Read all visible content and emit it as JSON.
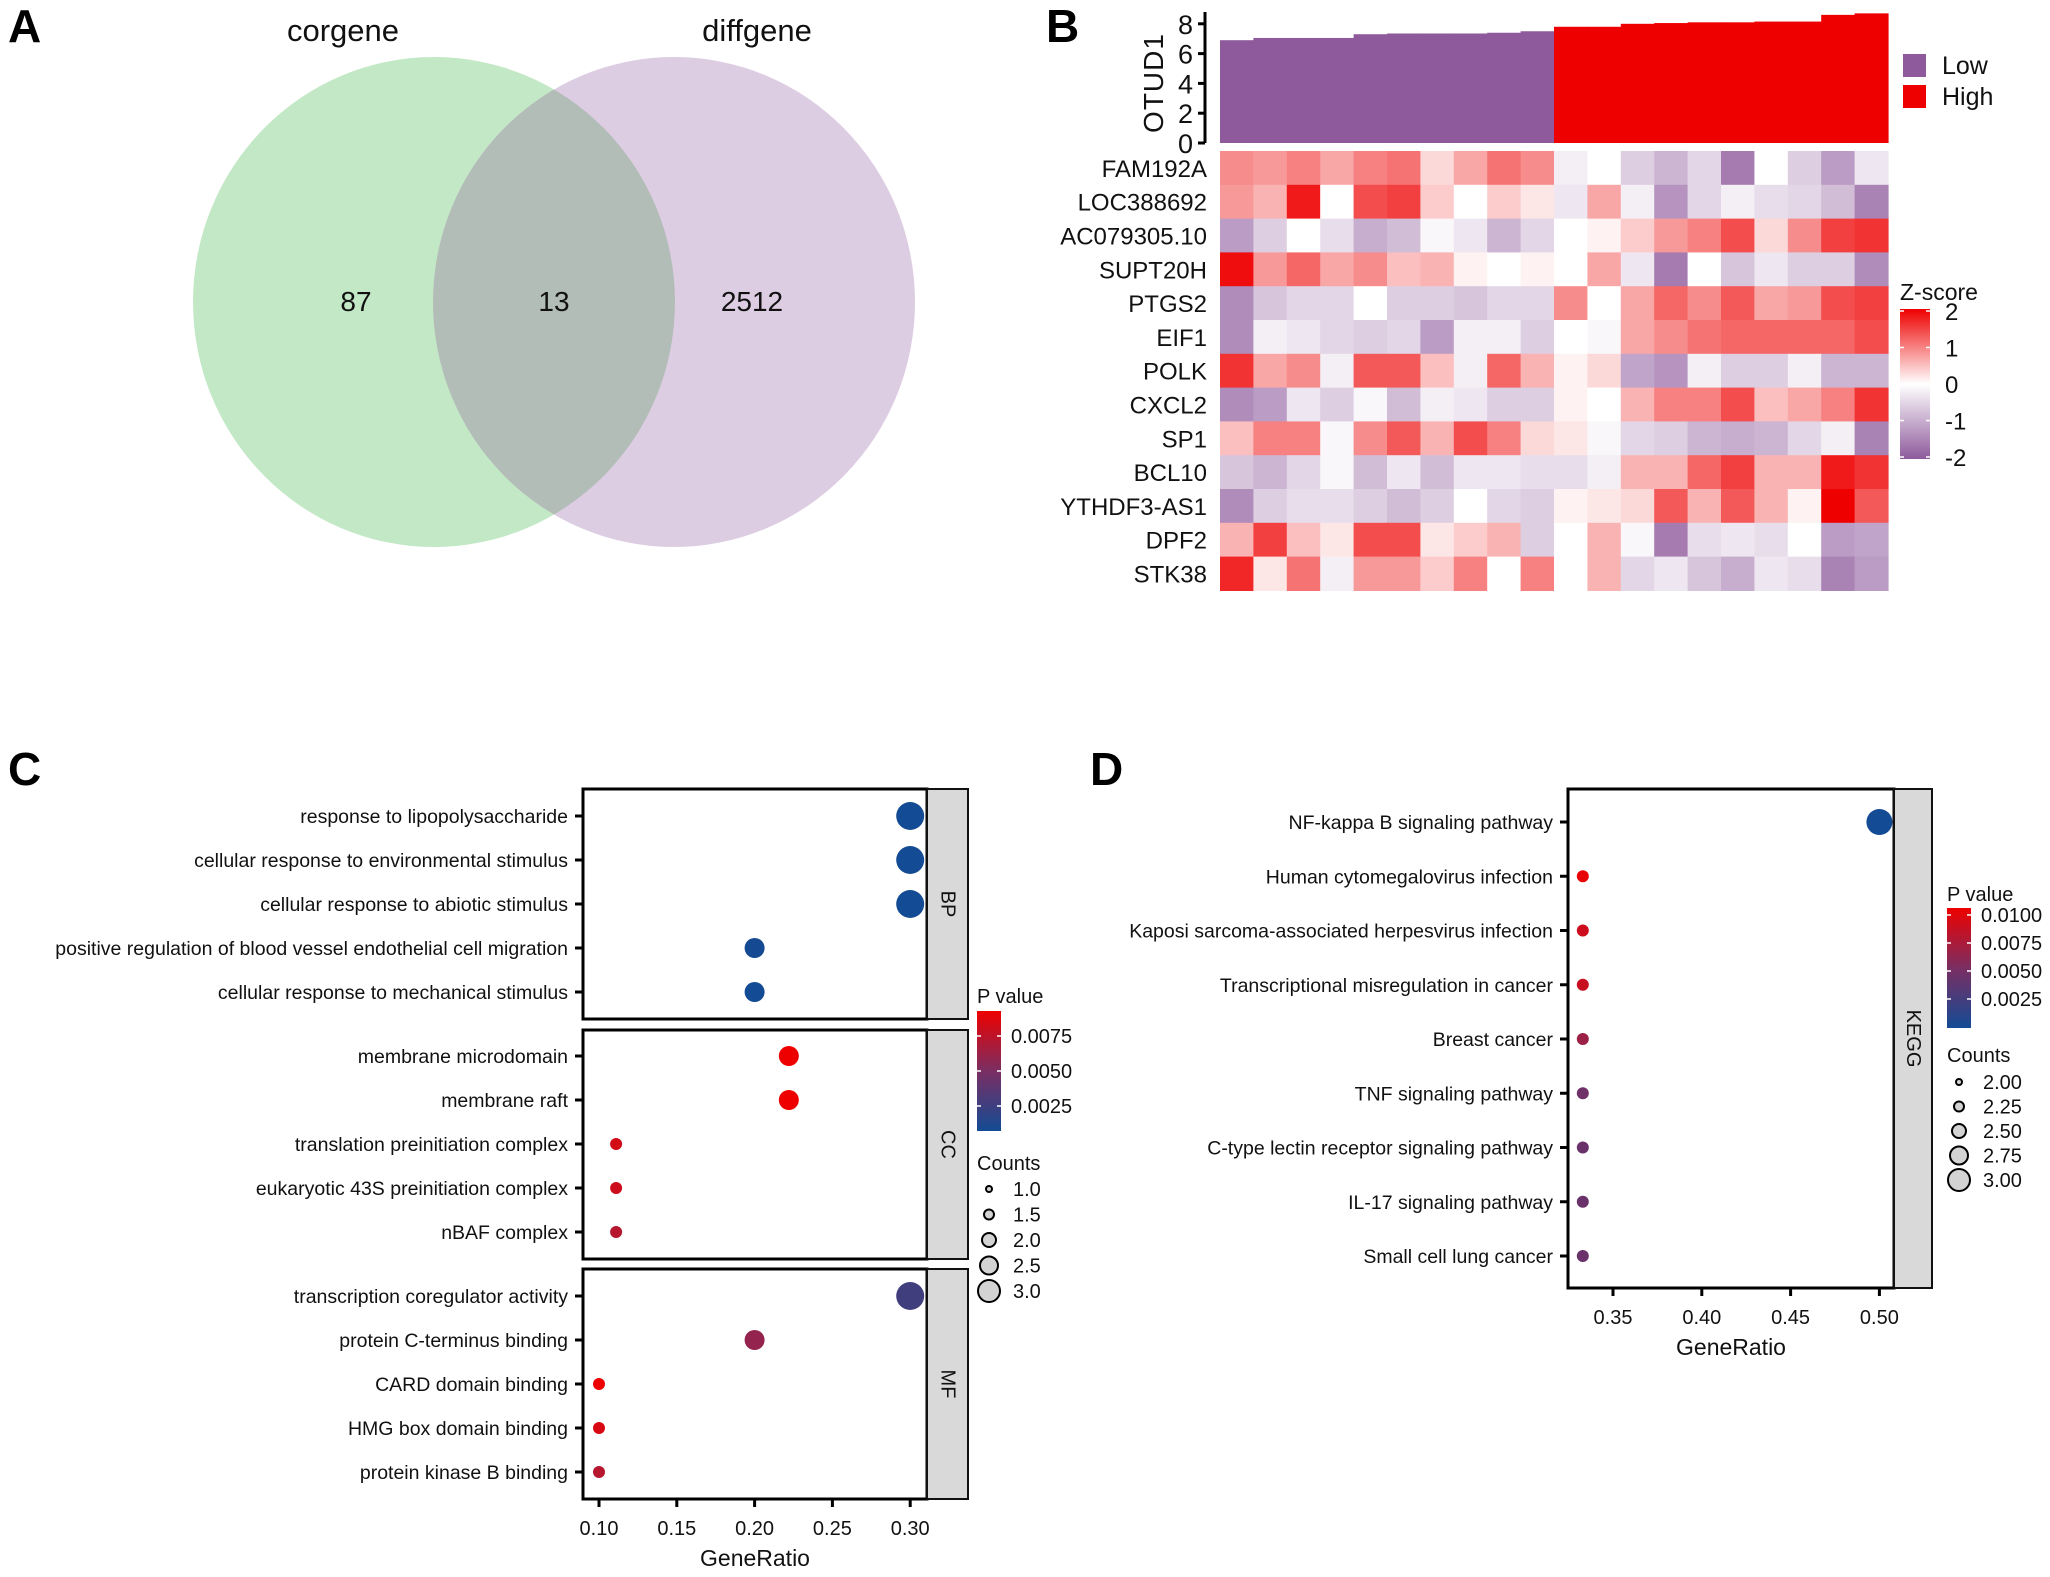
{
  "panels": {
    "A": {
      "letter": "A"
    },
    "B": {
      "letter": "B"
    },
    "C": {
      "letter": "C"
    },
    "D": {
      "letter": "D"
    }
  },
  "chart_data": [
    {
      "id": "A",
      "type": "venn",
      "sets": [
        {
          "name": "corgene",
          "color": "#3aab3a",
          "fill": "#c3e8c6"
        },
        {
          "name": "diffgene",
          "color": "#8e5a9c",
          "fill": "#ddcde3"
        }
      ],
      "overlap_fill": "#b3bdb7",
      "counts": {
        "corgene_only": "87",
        "both": "13",
        "diffgene_only": "2512"
      }
    },
    {
      "id": "B",
      "type": "heatmap",
      "annotation": {
        "ylabel": "OTUD1",
        "yticks": [
          "0",
          "2",
          "4",
          "6",
          "8"
        ],
        "ylim": [
          0,
          8
        ],
        "values": [
          6.9,
          7.05,
          7.05,
          7.05,
          7.3,
          7.35,
          7.35,
          7.35,
          7.4,
          7.5,
          7.8,
          7.8,
          8.0,
          8.05,
          8.1,
          8.1,
          8.15,
          8.15,
          8.6,
          8.7
        ],
        "groups": [
          "Low",
          "Low",
          "Low",
          "Low",
          "Low",
          "Low",
          "Low",
          "Low",
          "Low",
          "Low",
          "High",
          "High",
          "High",
          "High",
          "High",
          "High",
          "High",
          "High",
          "High",
          "High"
        ],
        "legend": [
          {
            "label": "Low",
            "color": "#8e5a9c"
          },
          {
            "label": "High",
            "color": "#ee0000"
          }
        ]
      },
      "rows": [
        "FAM192A",
        "LOC388692",
        "AC079305.10",
        "SUPT20H",
        "PTGS2",
        "EIF1",
        "POLK",
        "CXCL2",
        "SP1",
        "BCL10",
        "YTHDF3-AS1",
        "DPF2",
        "STK38"
      ],
      "values": [
        [
          0.9,
          0.8,
          1.0,
          0.7,
          1.0,
          1.1,
          0.3,
          0.7,
          1.1,
          0.9,
          -0.2,
          0,
          -0.6,
          -0.9,
          -0.5,
          -1.6,
          0,
          -0.6,
          -1.2,
          -0.3
        ],
        [
          0.8,
          0.6,
          1.8,
          0,
          1.4,
          1.5,
          0.4,
          0,
          0.4,
          0.2,
          -0.3,
          0.7,
          -0.2,
          -1.3,
          -0.5,
          -0.2,
          -0.4,
          -0.5,
          -0.8,
          -1.5
        ],
        [
          -1.2,
          -0.6,
          0,
          -0.4,
          -1.0,
          -0.8,
          -0.1,
          -0.3,
          -0.9,
          -0.5,
          0,
          0.1,
          0.4,
          0.8,
          1.0,
          1.4,
          0.3,
          0.9,
          1.5,
          1.6
        ],
        [
          1.9,
          0.8,
          1.2,
          0.7,
          0.9,
          0.5,
          0.6,
          0.1,
          0,
          0.1,
          0,
          0.7,
          -0.3,
          -1.6,
          0,
          -0.7,
          -0.3,
          -0.6,
          -0.6,
          -1.4
        ],
        [
          -1.4,
          -0.7,
          -0.5,
          -0.5,
          0,
          -0.6,
          -0.6,
          -0.7,
          -0.5,
          -0.5,
          0.9,
          0,
          0.7,
          1.2,
          0.9,
          1.3,
          0.7,
          0.8,
          1.4,
          1.5
        ],
        [
          -1.4,
          -0.2,
          -0.3,
          -0.5,
          -0.6,
          -0.5,
          -1.2,
          -0.2,
          -0.2,
          -0.6,
          0,
          -0.1,
          0.7,
          0.9,
          1.1,
          1.2,
          1.2,
          1.2,
          1.2,
          1.4
        ],
        [
          1.6,
          0.7,
          0.9,
          -0.2,
          1.3,
          1.3,
          0.5,
          -0.2,
          1.2,
          0.6,
          0.1,
          0.3,
          -1.1,
          -1.3,
          -0.2,
          -0.6,
          -0.6,
          -0.2,
          -0.9,
          -0.9
        ],
        [
          -1.4,
          -1.2,
          -0.3,
          -0.6,
          -0.1,
          -0.8,
          -0.2,
          -0.3,
          -0.6,
          -0.6,
          0.1,
          0,
          0.6,
          1.0,
          1.0,
          1.4,
          0.5,
          0.7,
          1.0,
          1.6
        ],
        [
          0.5,
          1.0,
          1.0,
          -0.1,
          0.9,
          1.3,
          0.6,
          1.4,
          1.0,
          0.3,
          0.2,
          -0.1,
          -0.5,
          -0.6,
          -0.9,
          -1.0,
          -0.9,
          -0.5,
          -0.2,
          -1.5
        ],
        [
          -0.7,
          -0.9,
          -0.5,
          -0.1,
          -0.8,
          -0.3,
          -0.8,
          -0.3,
          -0.3,
          -0.4,
          -0.4,
          -0.2,
          0.6,
          0.6,
          1.2,
          1.5,
          0.6,
          0.6,
          1.8,
          1.6
        ],
        [
          -1.4,
          -0.6,
          -0.4,
          -0.4,
          -0.6,
          -0.8,
          -0.6,
          0,
          -0.5,
          -0.6,
          0.1,
          0.2,
          0.3,
          1.3,
          0.6,
          1.3,
          0.6,
          0.1,
          2.0,
          1.3
        ],
        [
          0.6,
          1.5,
          0.5,
          0.2,
          1.4,
          1.4,
          0.2,
          0.4,
          0.6,
          -0.6,
          0,
          0.6,
          -0.1,
          -1.6,
          -0.4,
          -0.3,
          -0.4,
          0,
          -1.2,
          -1.1
        ],
        [
          1.7,
          0.2,
          1.1,
          -0.2,
          0.8,
          0.8,
          0.4,
          1.0,
          0,
          1.0,
          0,
          0.6,
          -0.5,
          -0.3,
          -0.7,
          -1.0,
          -0.3,
          -0.4,
          -1.5,
          -1.2
        ]
      ],
      "colorbar": {
        "title": "Z-score",
        "ticks": [
          "2",
          "1",
          "0",
          "-1",
          "-2"
        ],
        "range": [
          -2,
          2
        ],
        "low": "#8e5a9c",
        "mid": "#ffffff",
        "high": "#ee0000"
      }
    },
    {
      "id": "C",
      "type": "scatter",
      "subtype": "dotplot",
      "xlabel": "GeneRatio",
      "xticks": [
        "0.10",
        "0.15",
        "0.20",
        "0.25",
        "0.30"
      ],
      "xlim": [
        0.09,
        0.31
      ],
      "facets": [
        {
          "name": "BP",
          "terms": [
            {
              "term": "response to lipopolysaccharide",
              "x": 0.3,
              "count": 3,
              "p": 0.0003
            },
            {
              "term": "cellular response to environmental stimulus",
              "x": 0.3,
              "count": 3,
              "p": 0.0003
            },
            {
              "term": "cellular response to abiotic stimulus",
              "x": 0.3,
              "count": 3,
              "p": 0.0003
            },
            {
              "term": "positive regulation of blood vessel endothelial cell migration",
              "x": 0.2,
              "count": 2,
              "p": 0.0004
            },
            {
              "term": "cellular response to mechanical stimulus",
              "x": 0.2,
              "count": 2,
              "p": 0.0003
            }
          ]
        },
        {
          "name": "CC",
          "terms": [
            {
              "term": "membrane microdomain",
              "x": 0.222,
              "count": 2,
              "p": 0.0088
            },
            {
              "term": "membrane raft",
              "x": 0.222,
              "count": 2,
              "p": 0.0088
            },
            {
              "term": "translation preinitiation complex",
              "x": 0.111,
              "count": 1,
              "p": 0.0078
            },
            {
              "term": "eukaryotic 43S preinitiation complex",
              "x": 0.111,
              "count": 1,
              "p": 0.0076
            },
            {
              "term": "nBAF complex",
              "x": 0.111,
              "count": 1,
              "p": 0.0068
            }
          ]
        },
        {
          "name": "MF",
          "terms": [
            {
              "term": "transcription coregulator activity",
              "x": 0.3,
              "count": 3,
              "p": 0.0022
            },
            {
              "term": "protein C-terminus binding",
              "x": 0.2,
              "count": 2,
              "p": 0.0055
            },
            {
              "term": "CARD domain binding",
              "x": 0.1,
              "count": 1,
              "p": 0.0088
            },
            {
              "term": "HMG box domain binding",
              "x": 0.1,
              "count": 1,
              "p": 0.008
            },
            {
              "term": "protein kinase B binding",
              "x": 0.1,
              "count": 1,
              "p": 0.0068
            }
          ]
        }
      ],
      "color_legend": {
        "title": "P value",
        "ticks": [
          "0.0075",
          "0.0050",
          "0.0025"
        ],
        "range": [
          0.0003,
          0.0088
        ],
        "low": "#134b94",
        "high": "#ee0000"
      },
      "size_legend": {
        "title": "Counts",
        "ticks": [
          "1.0",
          "1.5",
          "2.0",
          "2.5",
          "3.0"
        ],
        "values": [
          1.0,
          1.5,
          2.0,
          2.5,
          3.0
        ]
      }
    },
    {
      "id": "D",
      "type": "scatter",
      "subtype": "dotplot",
      "xlabel": "GeneRatio",
      "xticks": [
        "0.35",
        "0.40",
        "0.45",
        "0.50"
      ],
      "xlim": [
        0.326,
        0.51
      ],
      "facets": [
        {
          "name": "KEGG",
          "terms": [
            {
              "term": "NF-kappa B signaling pathway",
              "x": 0.5,
              "count": 3,
              "p": 0.0001
            },
            {
              "term": "Human cytomegalovirus infection",
              "x": 0.333,
              "count": 2,
              "p": 0.0102
            },
            {
              "term": "Kaposi sarcoma-associated herpesvirus infection",
              "x": 0.333,
              "count": 2,
              "p": 0.009
            },
            {
              "term": "Transcriptional misregulation in cancer",
              "x": 0.333,
              "count": 2,
              "p": 0.0088
            },
            {
              "term": "Breast cancer",
              "x": 0.333,
              "count": 2,
              "p": 0.0068
            },
            {
              "term": "TNF signaling pathway",
              "x": 0.333,
              "count": 2,
              "p": 0.0048
            },
            {
              "term": "C-type lectin receptor signaling pathway",
              "x": 0.333,
              "count": 2,
              "p": 0.0045
            },
            {
              "term": "IL-17 signaling pathway",
              "x": 0.333,
              "count": 2,
              "p": 0.0045
            },
            {
              "term": "Small cell lung cancer",
              "x": 0.333,
              "count": 2,
              "p": 0.0045
            }
          ]
        }
      ],
      "color_legend": {
        "title": "P value",
        "ticks": [
          "0.0100",
          "0.0075",
          "0.0050",
          "0.0025"
        ],
        "range": [
          0.0001,
          0.0105
        ],
        "low": "#134b94",
        "high": "#ee0000"
      },
      "size_legend": {
        "title": "Counts",
        "ticks": [
          "2.00",
          "2.25",
          "2.50",
          "2.75",
          "3.00"
        ],
        "values": [
          2.0,
          2.25,
          2.5,
          2.75,
          3.0
        ]
      }
    }
  ]
}
